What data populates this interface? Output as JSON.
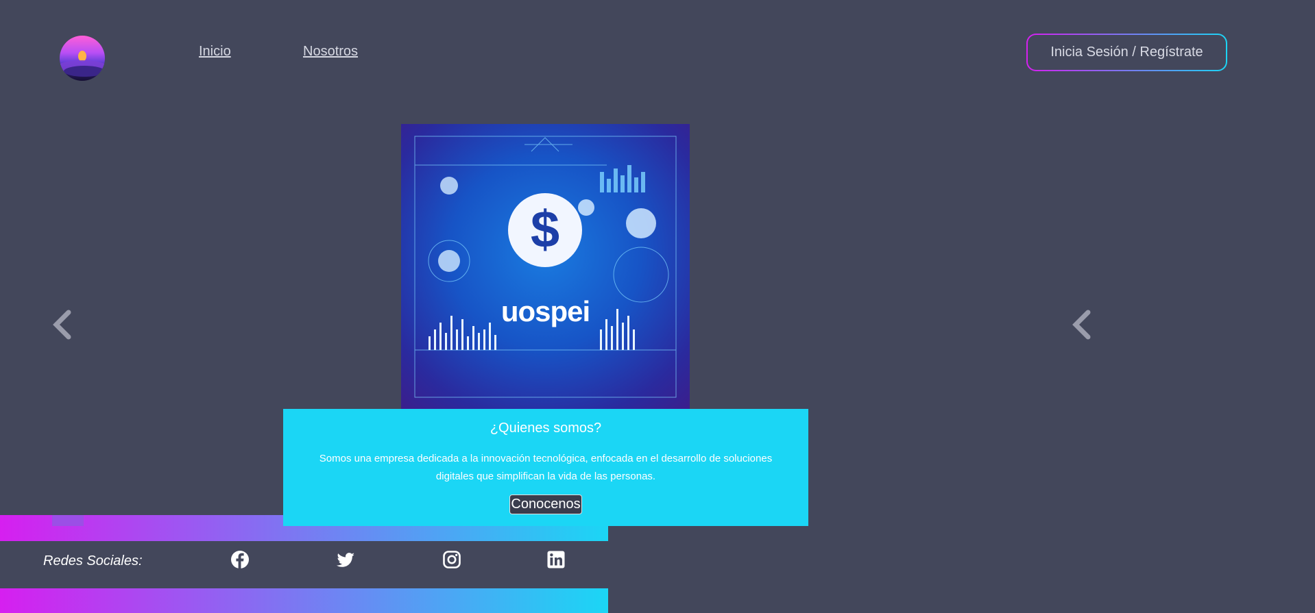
{
  "header": {
    "logo_name": "logo-icon",
    "nav": [
      {
        "label": "Inicio"
      },
      {
        "label": "Nosotros"
      }
    ],
    "login_label": "Inicia Sesión / Regístrate"
  },
  "carousel": {
    "prev_icon": "chevron-left-icon",
    "next_icon": "chevron-left-icon",
    "image_caption": "uospei"
  },
  "about": {
    "title": "¿Quienes somos?",
    "text": "Somos una empresa dedicada a la innovación tecnológica, enfocada en el desarrollo de soluciones digitales que simplifican la vida de las personas.",
    "button_label": "Conocenos"
  },
  "footer": {
    "label": "Redes Sociales:",
    "social": [
      "facebook-icon",
      "twitter-icon",
      "instagram-icon",
      "linkedin-icon"
    ]
  },
  "colors": {
    "background": "#43475b",
    "accent_cyan": "#1bd6f5",
    "accent_magenta": "#d61ff0"
  }
}
